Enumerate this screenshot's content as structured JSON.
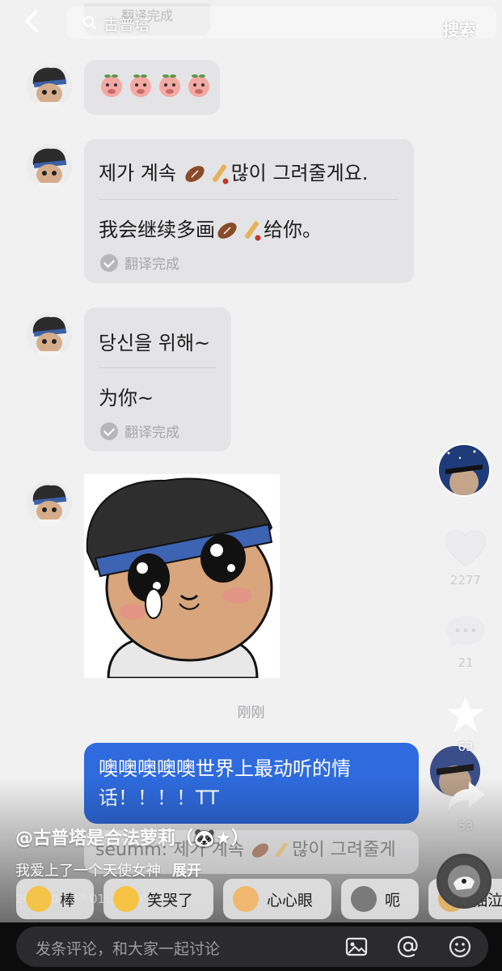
{
  "header": {
    "search_query": "古普塔",
    "search_button": "搜索",
    "ghost_status": "翻译完成"
  },
  "messages": [
    {
      "type": "emoji",
      "emoji": [
        "peach-face",
        "peach-face",
        "peach-face",
        "peach-face"
      ]
    },
    {
      "type": "translated",
      "original_before": "제가 계속 ",
      "original_after": "많이 그려줄게요.",
      "translation_before": "我会继续多画",
      "translation_after": "给你。",
      "status": "翻译完成"
    },
    {
      "type": "translated",
      "original": "당신을 위해~",
      "translation": "为你~",
      "status": "翻译完成"
    },
    {
      "type": "sticker",
      "sticker": "crying-boy-headband-sticker"
    }
  ],
  "timestamp": "刚刚",
  "sent_message": "噢噢噢噢噢世界上最动听的情话！！！！TT",
  "rail": {
    "likes": "2277",
    "comments": "21",
    "favorites": "63",
    "shares": "53"
  },
  "overlay": {
    "author": "@古普塔是合法萝莉（🐼★）",
    "caption": "我爱上了一个天使女神",
    "expand": "展开",
    "date": "2026-02-07 01:36 · IP：广东",
    "ghost_quote_before": "seumm: 제가 계속 ",
    "ghost_quote_after": "많이 그려줄게"
  },
  "reactions": [
    {
      "label": "棒"
    },
    {
      "label": "笑哭了"
    },
    {
      "label": "心心眼"
    },
    {
      "label": "呃"
    },
    {
      "label": "抽泣"
    }
  ],
  "comment_bar": {
    "placeholder": "发条评论，和大家一起讨论"
  },
  "colors": {
    "sent_bubble": "#2f6bde",
    "received_bubble": "#e4e4e6",
    "background": "#f1f1f2"
  }
}
